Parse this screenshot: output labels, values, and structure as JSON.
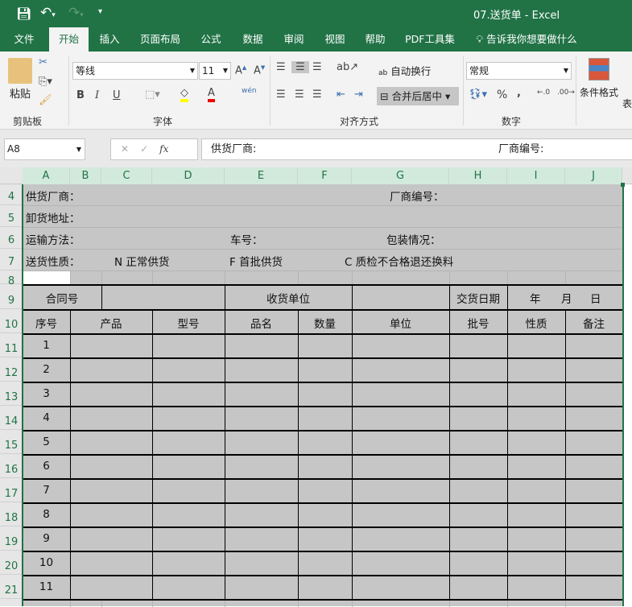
{
  "title": "07.送货单  -  Excel",
  "qat": {
    "save": "save-icon",
    "undo": "undo-icon",
    "redo": "redo-icon",
    "customize": "▾"
  },
  "tabs": [
    "文件",
    "开始",
    "插入",
    "页面布局",
    "公式",
    "数据",
    "审阅",
    "视图",
    "帮助",
    "PDF工具集"
  ],
  "tell_me": "告诉我你想要做什么",
  "ribbon": {
    "clipboard": {
      "paste": "粘贴",
      "label": "剪贴板"
    },
    "font": {
      "name": "等线",
      "size": "11",
      "bold": "B",
      "italic": "I",
      "underline": "U",
      "phonetic": "wén",
      "label": "字体"
    },
    "alignment": {
      "wrap": "自动换行",
      "merge": "合并后居中",
      "label": "对齐方式"
    },
    "number": {
      "format": "常规",
      "percent": "%",
      "comma": ",",
      "label": "数字"
    },
    "styles": {
      "cond": "条件格式",
      "table": "表"
    }
  },
  "formula_bar": {
    "name_box": "A8",
    "fx": "fx",
    "content": "供货厂商:",
    "content2": "厂商编号:"
  },
  "columns": [
    "A",
    "B",
    "C",
    "D",
    "E",
    "F",
    "G",
    "H",
    "I",
    "J"
  ],
  "rows": [
    "4",
    "5",
    "6",
    "7",
    "8",
    "9",
    "10",
    "11",
    "12",
    "13",
    "14",
    "15",
    "16",
    "17",
    "18",
    "19",
    "20",
    "21"
  ],
  "sheet": {
    "r4": [
      "供货厂商：",
      "厂商编号："
    ],
    "r5": [
      "卸货地址："
    ],
    "r6": [
      "运输方法：",
      "车号：",
      "包装情况："
    ],
    "r7": [
      "送货性质：",
      "N 正常供货",
      "F  首批供货",
      "C  质检不合格退还换料"
    ],
    "r9": [
      "合同号",
      "收货单位",
      "交货日期",
      "年",
      "月",
      "日"
    ],
    "headers": [
      "序号",
      "产品",
      "型号",
      "品名",
      "数量",
      "单位",
      "批号",
      "性质",
      "备注"
    ],
    "numbers": [
      "1",
      "2",
      "3",
      "4",
      "5",
      "6",
      "7",
      "8",
      "9",
      "10",
      "11"
    ]
  },
  "colors": {
    "brand": "#217346",
    "selection": "#c6c6c6"
  }
}
